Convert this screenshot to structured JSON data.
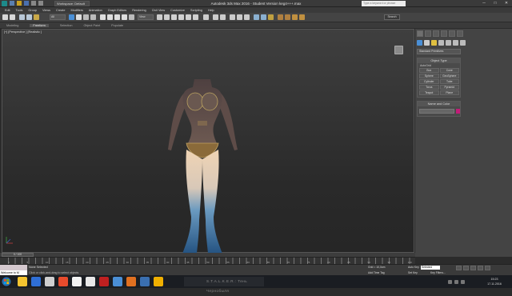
{
  "titlebar": {
    "workspace": "Workspace: Default",
    "title": "Autodesk 3ds Max 2016 - Student Version    keg4+++.max",
    "search_placeholder": "Type a keyword or phrase",
    "minimize": "─",
    "maximize": "□",
    "close": "✕"
  },
  "menubar": {
    "items": [
      "Edit",
      "Tools",
      "Group",
      "Views",
      "Create",
      "Modifiers",
      "Animation",
      "Graph Editors",
      "Rendering",
      "Civil View",
      "Customize",
      "Scripting",
      "Help"
    ]
  },
  "toolbar": {
    "selection_filter": "All",
    "reference": "View",
    "search_label": "Search"
  },
  "ribbon": {
    "tabs": [
      "Modeling",
      "Freeform",
      "Selection",
      "Object Paint",
      "Populate"
    ],
    "active_index": 1
  },
  "viewport": {
    "label": "[+] [Perspective ] [Realistic ]"
  },
  "command_panel": {
    "category": "Standard Primitives",
    "object_type_title": "Object Type",
    "autogrid": "AutoGrid",
    "buttons": [
      "Box",
      "Cone",
      "Sphere",
      "GeoSphere",
      "Cylinder",
      "Tube",
      "Torus",
      "Pyramid",
      "Teapot",
      "Plane"
    ],
    "name_color_title": "Name and Color",
    "object_color": "#c21c78"
  },
  "timeline": {
    "slider": "0 / 100",
    "ticks": [
      "0",
      "5",
      "10",
      "15",
      "20",
      "25",
      "30",
      "35",
      "40",
      "45",
      "50",
      "55",
      "60",
      "65",
      "70",
      "75",
      "80",
      "85",
      "90",
      "95",
      "100"
    ]
  },
  "status": {
    "maxscript": "Welcome to M",
    "selection": "None Selected",
    "hint": "Click or click-and-drag to select objects",
    "grid": "Grid = 10,0cm",
    "add_time_tag": "Add Time Tag",
    "auto_key": "Auto Key",
    "selected": "Selected",
    "set_key": "Set Key",
    "key_filters": "Key Filters..."
  },
  "taskbar": {
    "stalker": "S.T.A.L.K.E.R.: Тень Чернобыля",
    "time": "15:23",
    "date": "17.11.2016",
    "app_colors": [
      "#f4c430",
      "#2f6fd6",
      "#cfcfcf",
      "#e84b2c",
      "#f2f2f2",
      "#e8e8e8",
      "#c02020",
      "#4a8fd6",
      "#e07020",
      "#3a6fb0",
      "#f0b000"
    ]
  }
}
